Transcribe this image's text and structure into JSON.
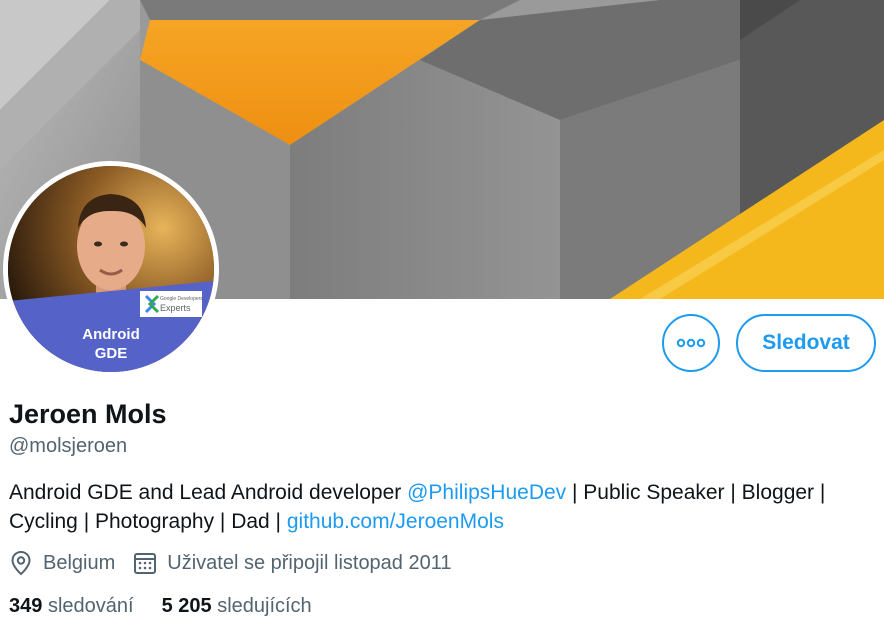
{
  "profile": {
    "name": "Jeroen Mols",
    "handle": "@molsjeroen",
    "avatar_badge_line1": "Android",
    "avatar_badge_line2": "GDE",
    "avatar_logo_small": "Google Developers",
    "avatar_logo_main": "Experts"
  },
  "actions": {
    "more_icon": "more-dots-icon",
    "follow_label": "Sledovat"
  },
  "bio": {
    "part1": "Android GDE and Lead Android developer ",
    "mention": "@PhilipsHueDev",
    "part2": " | Public Speaker | Blogger | Cycling | Photography | Dad | ",
    "link": "github.com/JeroenMols"
  },
  "meta": {
    "location": "Belgium",
    "location_icon": "location-pin-icon",
    "joined": "Uživatel se připojil listopad 2011",
    "joined_icon": "calendar-icon"
  },
  "stats": {
    "following_count": "349",
    "following_label": "sledování",
    "followers_count": "5 205",
    "followers_label": "sledujících"
  },
  "colors": {
    "accent": "#1d9bf0",
    "text": "#0f1419",
    "muted": "#536471",
    "banner_orange": "#f39a1e",
    "banner_yellow": "#f5b81c",
    "badge_blue": "#5563c9"
  }
}
